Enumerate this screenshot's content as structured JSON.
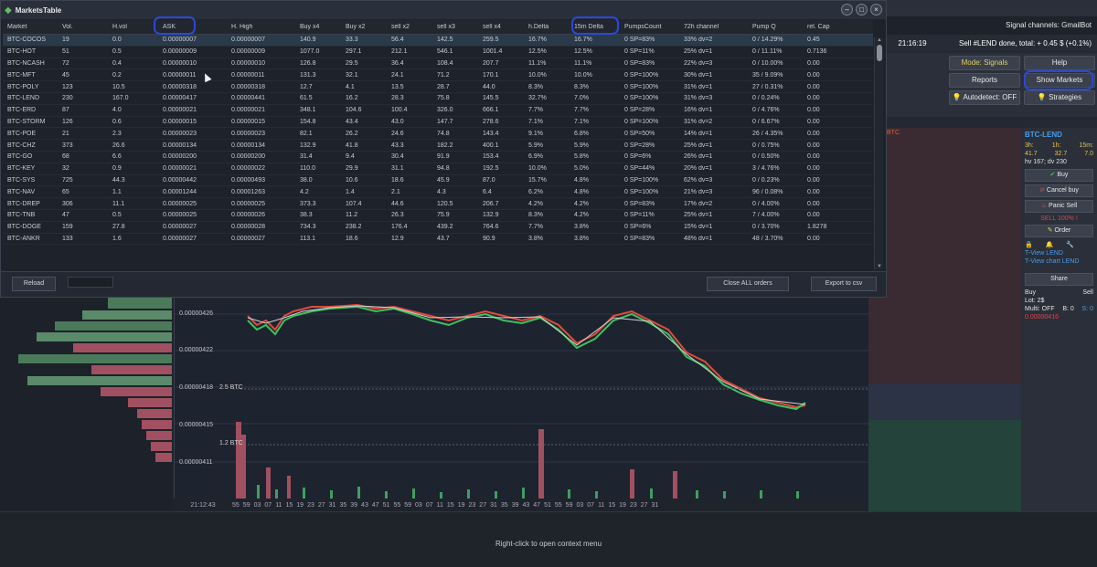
{
  "window": {
    "title": "MarketsTable",
    "buttons": [
      "–",
      "□",
      "×"
    ]
  },
  "table": {
    "columns": [
      "Market",
      "Vol.",
      "H.vol",
      "ASK",
      "H. High",
      "Buy x4",
      "Buy x2",
      "sell x2",
      "sell x3",
      "sell x4",
      "h.Delta",
      "15m Delta",
      "PumpsCount",
      "72h channel",
      "Pump Q",
      "rel. Cap"
    ],
    "rows": [
      [
        "BTC-COCOS",
        "19",
        "0.0",
        "0.00000007",
        "0.00000007",
        "140.9",
        "33.3",
        "56.4",
        "142.5",
        "259.5",
        "16.7%",
        "16.7%",
        "0 SP=83%",
        "33% dv=2",
        "0 / 14.29%",
        "0.45"
      ],
      [
        "BTC-HOT",
        "51",
        "0.5",
        "0.00000009",
        "0.00000009",
        "1077.0",
        "297.1",
        "212.1",
        "546.1",
        "1001.4",
        "12.5%",
        "12.5%",
        "0 SP=11%",
        "25% dv=1",
        "0 / 11.11%",
        "0.7136"
      ],
      [
        "BTC-NCASH",
        "72",
        "0.4",
        "0.00000010",
        "0.00000010",
        "126.8",
        "29.5",
        "36.4",
        "108.4",
        "207.7",
        "11.1%",
        "11.1%",
        "0 SP=83%",
        "22% dv=3",
        "0 / 10.00%",
        "0.00"
      ],
      [
        "BTC-MFT",
        "45",
        "0.2",
        "0.00000011",
        "0.00000011",
        "131.3",
        "32.1",
        "24.1",
        "71.2",
        "170.1",
        "10.0%",
        "10.0%",
        "0 SP=100%",
        "30% dv=1",
        "35 / 9.09%",
        "0.00"
      ],
      [
        "BTC-POLY",
        "123",
        "10.5",
        "0.00000318",
        "0.00000318",
        "12.7",
        "4.1",
        "13.5",
        "28.7",
        "44.0",
        "8.3%",
        "8.3%",
        "0 SP=100%",
        "31% dv=1",
        "27 / 0.31%",
        "0.00"
      ],
      [
        "BTC-LEND",
        "230",
        "167.0",
        "0.00000417",
        "0.00000441",
        "61.5",
        "16.2",
        "28.3",
        "75.8",
        "145.5",
        "32.7%",
        "7.0%",
        "0 SP=100%",
        "31% dv=3",
        "0 / 0.24%",
        "0.00"
      ],
      [
        "BTC-ERD",
        "87",
        "4.0",
        "0.00000021",
        "0.00000021",
        "348.1",
        "104.6",
        "100.4",
        "326.0",
        "666.1",
        "7.7%",
        "7.7%",
        "0 SP=28%",
        "16% dv=1",
        "0 / 4.76%",
        "0.00"
      ],
      [
        "BTC-STORM",
        "126",
        "0.6",
        "0.00000015",
        "0.00000015",
        "154.8",
        "43.4",
        "43.0",
        "147.7",
        "278.6",
        "7.1%",
        "7.1%",
        "0 SP=100%",
        "31% dv=2",
        "0 / 6.67%",
        "0.00"
      ],
      [
        "BTC-POE",
        "21",
        "2.3",
        "0.00000023",
        "0.00000023",
        "82.1",
        "26.2",
        "24.6",
        "74.8",
        "143.4",
        "9.1%",
        "6.8%",
        "0 SP=50%",
        "14% dv=1",
        "26 / 4.35%",
        "0.00"
      ],
      [
        "BTC-CHZ",
        "373",
        "26.6",
        "0.00000134",
        "0.00000134",
        "132.9",
        "41.8",
        "43.3",
        "182.2",
        "400.1",
        "5.9%",
        "5.9%",
        "0 SP=28%",
        "25% dv=1",
        "0 / 0.75%",
        "0.00"
      ],
      [
        "BTC-GO",
        "68",
        "6.6",
        "0.00000200",
        "0.00000200",
        "31.4",
        "9.4",
        "30.4",
        "91.9",
        "153.4",
        "6.9%",
        "5.8%",
        "0 SP=6%",
        "26% dv=1",
        "0 / 0.50%",
        "0.00"
      ],
      [
        "BTC-KEY",
        "32",
        "0.9",
        "0.00000021",
        "0.00000022",
        "110.0",
        "29.9",
        "31.1",
        "94.8",
        "192.5",
        "10.0%",
        "5.0%",
        "0 SP=44%",
        "20% dv=1",
        "3 / 4.76%",
        "0.00"
      ],
      [
        "BTC-SYS",
        "725",
        "44.3",
        "0.00000442",
        "0.00000493",
        "38.0",
        "10.6",
        "18.6",
        "45.9",
        "87.0",
        "15.7%",
        "4.8%",
        "0 SP=100%",
        "62% dv=3",
        "0 / 0.23%",
        "0.00"
      ],
      [
        "BTC-NAV",
        "65",
        "1.1",
        "0.00001244",
        "0.00001263",
        "4.2",
        "1.4",
        "2.1",
        "4.3",
        "6.4",
        "6.2%",
        "4.8%",
        "0 SP=100%",
        "21% dv=3",
        "96 / 0.08%",
        "0.00"
      ],
      [
        "BTC-DREP",
        "306",
        "11.1",
        "0.00000025",
        "0.00000025",
        "373.3",
        "107.4",
        "44.6",
        "120.5",
        "206.7",
        "4.2%",
        "4.2%",
        "0 SP=83%",
        "17% dv=2",
        "0 / 4.00%",
        "0.00"
      ],
      [
        "BTC-TNB",
        "47",
        "0.5",
        "0.00000025",
        "0.00000026",
        "38.3",
        "11.2",
        "26.3",
        "75.9",
        "132.9",
        "8.3%",
        "4.2%",
        "0 SP=11%",
        "25% dv=1",
        "7 / 4.00%",
        "0.00"
      ],
      [
        "BTC-DOGE",
        "159",
        "27.8",
        "0.00000027",
        "0.00000028",
        "734.3",
        "238.2",
        "176.4",
        "439.2",
        "764.6",
        "7.7%",
        "3.8%",
        "0 SP=6%",
        "15% dv=1",
        "0 / 3.70%",
        "1.8278"
      ],
      [
        "BTC-ANKR",
        "133",
        "1.6",
        "0.00000027",
        "0.00000027",
        "113.1",
        "18.6",
        "12.9",
        "43.7",
        "90.9",
        "3.8%",
        "3.8%",
        "0 SP=83%",
        "48% dv=1",
        "48 / 3.70%",
        "0.00"
      ]
    ]
  },
  "footer": {
    "reload": "Reload",
    "close_all": "Close ALL orders",
    "export": "Export to csv"
  },
  "right_top": {
    "signal_channels": "Signal channels: GmailBot",
    "time": "21:16:19",
    "message": "Sell #LEND done, total: + 0.45 $ (+0.1%)",
    "mode": "Mode: Signals",
    "help": "Help",
    "reports": "Reports",
    "show_markets": "Show Markets",
    "autodetect": "Autodetect: OFF",
    "strategies": "Strategies"
  },
  "side_panel": {
    "pair": "BTC-LEND",
    "tf_labels": [
      "3h:",
      "1h:",
      "15m:"
    ],
    "tf_values": [
      "41.7",
      "32.7",
      "7.0"
    ],
    "hv": "hv 167; dv 230",
    "buy": "Buy",
    "cancel_buy": "Cancel buy",
    "panic_sell": "Panic Sell",
    "sell_pct": "SELL 100% !",
    "order": "Order",
    "tview": "T-View LEND",
    "tview_chart": "T-View chart LEND",
    "share": "Share",
    "buy_small": "Buy",
    "sell_small": "Sell",
    "lot": "Lot: 2$",
    "multi": "Multi: OFF",
    "b_value": "B: 0",
    "s_value": "S: 0",
    "price": "0.00000416"
  },
  "chart": {
    "prices": [
      "0.00000426",
      "0.00000422",
      "0.00000418",
      "0.00000415",
      "0.00000411"
    ],
    "vol_labels": [
      "2.5 BTC",
      "1.2 BTC"
    ],
    "time_start": "21:12:43",
    "ticks": [
      "55",
      "59",
      "03",
      "07",
      "11",
      "15",
      "19",
      "23",
      "27",
      "31",
      "35",
      "39",
      "43",
      "47",
      "51",
      "55",
      "59",
      "03",
      "07",
      "11",
      "15",
      "19",
      "23",
      "27",
      "31",
      "35",
      "39",
      "43",
      "47",
      "51",
      "55",
      "59",
      "03",
      "07",
      "11",
      "15",
      "19",
      "23",
      "27",
      "31",
      "35",
      "39",
      "43",
      "47",
      "51",
      "55",
      "59",
      "03",
      "07",
      "11",
      "15",
      "19",
      "23",
      "27",
      "31",
      "35",
      "39"
    ],
    "btc_label": "BTC"
  },
  "status": {
    "hint": "Right-click to open context menu"
  },
  "colors": {
    "accent_blue": "#2b47d8",
    "green": "#3fbf5f",
    "red": "#d04040"
  }
}
